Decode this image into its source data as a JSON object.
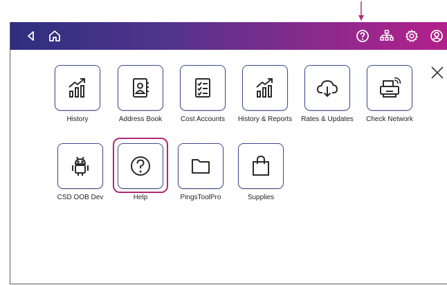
{
  "topbar": {
    "icons": [
      "back-icon",
      "home-icon",
      "help-icon",
      "network-icon",
      "settings-icon",
      "account-icon"
    ]
  },
  "tiles": [
    {
      "label": "History",
      "icon": "history-icon"
    },
    {
      "label": "Address Book",
      "icon": "address-book-icon"
    },
    {
      "label": "Cost Accounts",
      "icon": "cost-accounts-icon"
    },
    {
      "label": "History & Reports",
      "icon": "history-reports-icon"
    },
    {
      "label": "Rates & Updates",
      "icon": "cloud-download-icon"
    },
    {
      "label": "Check Network",
      "icon": "check-network-icon"
    },
    {
      "label": "CSD OOB Dev",
      "icon": "android-icon"
    },
    {
      "label": "Help",
      "icon": "help-icon"
    },
    {
      "label": "PingsToolPro",
      "icon": "folder-icon"
    },
    {
      "label": "Supplies",
      "icon": "shopping-bag-icon"
    }
  ],
  "colors": {
    "accent": "#3e4a8f",
    "highlight": "#b02878",
    "annotation_arrow": "#b02878"
  }
}
